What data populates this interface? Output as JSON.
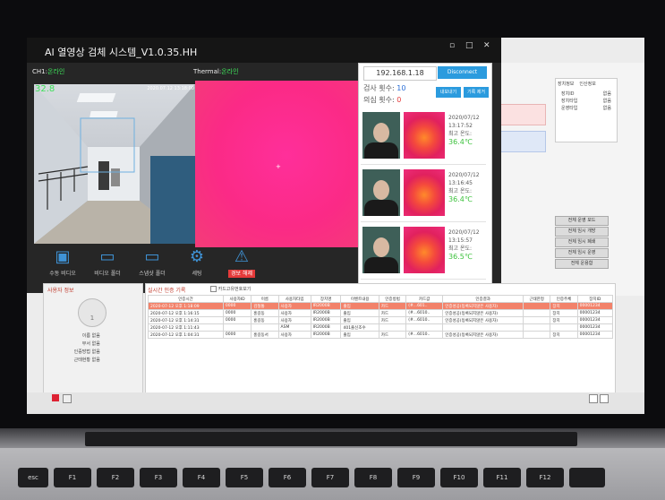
{
  "app": {
    "title": "AI 열영상 검체 시스템_V1.0.35.HH",
    "window_buttons": [
      "▫",
      "□",
      "✕"
    ]
  },
  "channels": {
    "ch1_label": "CH1:",
    "ch1_status": "온라인",
    "thermal_label": "Thermal:",
    "thermal_status": "온라인",
    "temp_overlay": "32.8",
    "timestamp_overlay": "2020.07.12 13:18:00"
  },
  "toolbar": [
    {
      "label": "수동 비디오",
      "icon": "camera-icon"
    },
    {
      "label": "비디오 폴더",
      "icon": "folder-icon"
    },
    {
      "label": "스냅샷 폴더",
      "icon": "folder-icon"
    },
    {
      "label": "세팅",
      "icon": "gear-icon"
    },
    {
      "label": "경보 해제",
      "icon": "warning-icon"
    }
  ],
  "dock": {
    "ip": "192.168.1.18",
    "disconnect": "Disconnect",
    "inspect_label": "검사 횟수: ",
    "inspect_count": "10",
    "suspect_label": "의심 횟수: ",
    "suspect_count": "0",
    "export_btn": "내보내기",
    "clear_btn": "기록 제거",
    "records": [
      {
        "date": "2020/07/12",
        "time": "13:17:52",
        "label": "최고 온도:",
        "temp": "36.4℃"
      },
      {
        "date": "2020/07/12",
        "time": "13:16:45",
        "label": "최고 온도:",
        "temp": "36.4℃"
      },
      {
        "date": "2020/07/12",
        "time": "13:15:57",
        "label": "최고 온도:",
        "temp": "36.5℃"
      }
    ]
  },
  "background": {
    "tabs": [
      "장치정보",
      "인산정보"
    ],
    "info_rows": [
      "장치ID",
      "장치타입",
      "운영타입"
    ],
    "info_vals": [
      "없음",
      "없음",
      "없음"
    ],
    "side_buttons": [
      "전체 운영 모드",
      "전체 임시 개방",
      "전체 임시 폐쇄",
      "전체 임시 운영",
      "전체 운용함"
    ]
  },
  "user_panel": {
    "title": "사용자 정보",
    "avatar_num": "1",
    "fields": [
      {
        "k": "이름",
        "v": "없음"
      },
      {
        "k": "부서",
        "v": "없음"
      },
      {
        "k": "인증방법",
        "v": "없음"
      },
      {
        "k": "근태현황",
        "v": "없음"
      }
    ]
  },
  "log_panel": {
    "title": "실시간 인증 기록",
    "checkbox_label": "카드고유번호보기",
    "headers": [
      "인증시간",
      "사용자ID",
      "이름",
      "사용자타입",
      "장치명",
      "이벤트내용",
      "인증방법",
      "카드값",
      "인증결과",
      "근태한정",
      "인증주체",
      "장치ID"
    ],
    "rows": [
      [
        "2020-07-12 오후 1:18:09",
        "0000",
        "김철통",
        "사용자",
        "IR2000B",
        "출입",
        "카드",
        "(#...601..",
        "인증성공(등록되지않은 사용자)",
        "",
        "장치",
        "00001234"
      ],
      [
        "2020-07-12 오후 1:16:15",
        "0000",
        "홍길동",
        "사용자",
        "IR2000B",
        "출입",
        "카드",
        "(#...6010..",
        "인증성공(등록되지않은 사용자)",
        "",
        "장치",
        "00001234"
      ],
      [
        "2020-07-12 오후 1:14:31",
        "0000",
        "홍길동",
        "사용자",
        "IR2000B",
        "출입",
        "카드",
        "(#...6010..",
        "인증성공(등록되지않은 사용자)",
        "",
        "장치",
        "00001234"
      ],
      [
        "2020-07-12 오후 1:11:43",
        "",
        "",
        "ASM",
        "IR2000B",
        "401출신조수",
        "",
        "",
        "",
        "",
        "",
        "00001234"
      ],
      [
        "2020-07-12 오후 1:04:31",
        "0000",
        "홍길동서",
        "사용자",
        "IR2000B",
        "출입",
        "카드",
        "(#...6010..",
        "인증성공(등록되지않은 사용자)",
        "",
        "장치",
        "00001234"
      ]
    ]
  },
  "keyboard": {
    "keys": [
      "esc",
      "F1",
      "F2",
      "F3",
      "F4",
      "F5",
      "F6",
      "F7",
      "F8",
      "F9",
      "F10",
      "F11",
      "F12",
      ""
    ]
  }
}
